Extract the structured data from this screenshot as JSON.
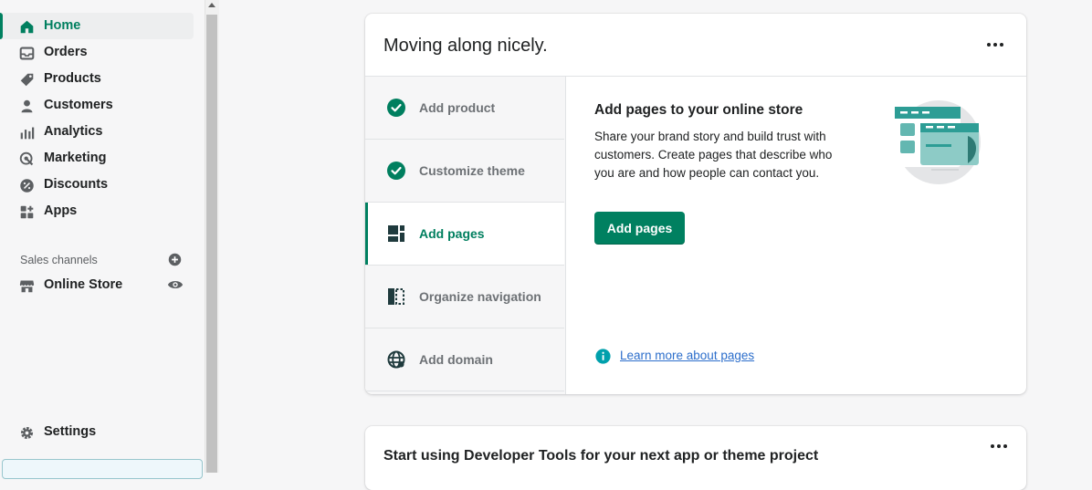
{
  "sidebar": {
    "items": [
      {
        "label": "Home",
        "icon": "home-icon",
        "active": true
      },
      {
        "label": "Orders",
        "icon": "inbox-icon"
      },
      {
        "label": "Products",
        "icon": "tag-icon"
      },
      {
        "label": "Customers",
        "icon": "person-icon"
      },
      {
        "label": "Analytics",
        "icon": "bar-chart-icon"
      },
      {
        "label": "Marketing",
        "icon": "target-icon"
      },
      {
        "label": "Discounts",
        "icon": "discount-icon"
      },
      {
        "label": "Apps",
        "icon": "apps-icon"
      }
    ],
    "sales_channels_heading": "Sales channels",
    "online_store": "Online Store",
    "settings": "Settings"
  },
  "setup_card": {
    "title": "Moving along nicely.",
    "steps": [
      {
        "label": "Add product",
        "status": "complete",
        "icon": "check-circle-icon"
      },
      {
        "label": "Customize theme",
        "status": "complete",
        "icon": "check-circle-icon"
      },
      {
        "label": "Add pages",
        "status": "current",
        "icon": "pages-icon"
      },
      {
        "label": "Organize navigation",
        "status": "pending",
        "icon": "navigation-icon"
      },
      {
        "label": "Add domain",
        "status": "pending",
        "icon": "globe-icon"
      }
    ],
    "detail": {
      "title": "Add pages to your online store",
      "description": "Share your brand story and build trust with customers. Create pages that describe who you are and how people can contact you.",
      "button": "Add pages",
      "link": "Learn more about pages"
    }
  },
  "dev_card": {
    "title": "Start using Developer Tools for your next app or theme project"
  },
  "colors": {
    "accent": "#008060",
    "active_text": "#007f5f",
    "link": "#2c6ecb",
    "info": "#00a0ac"
  }
}
